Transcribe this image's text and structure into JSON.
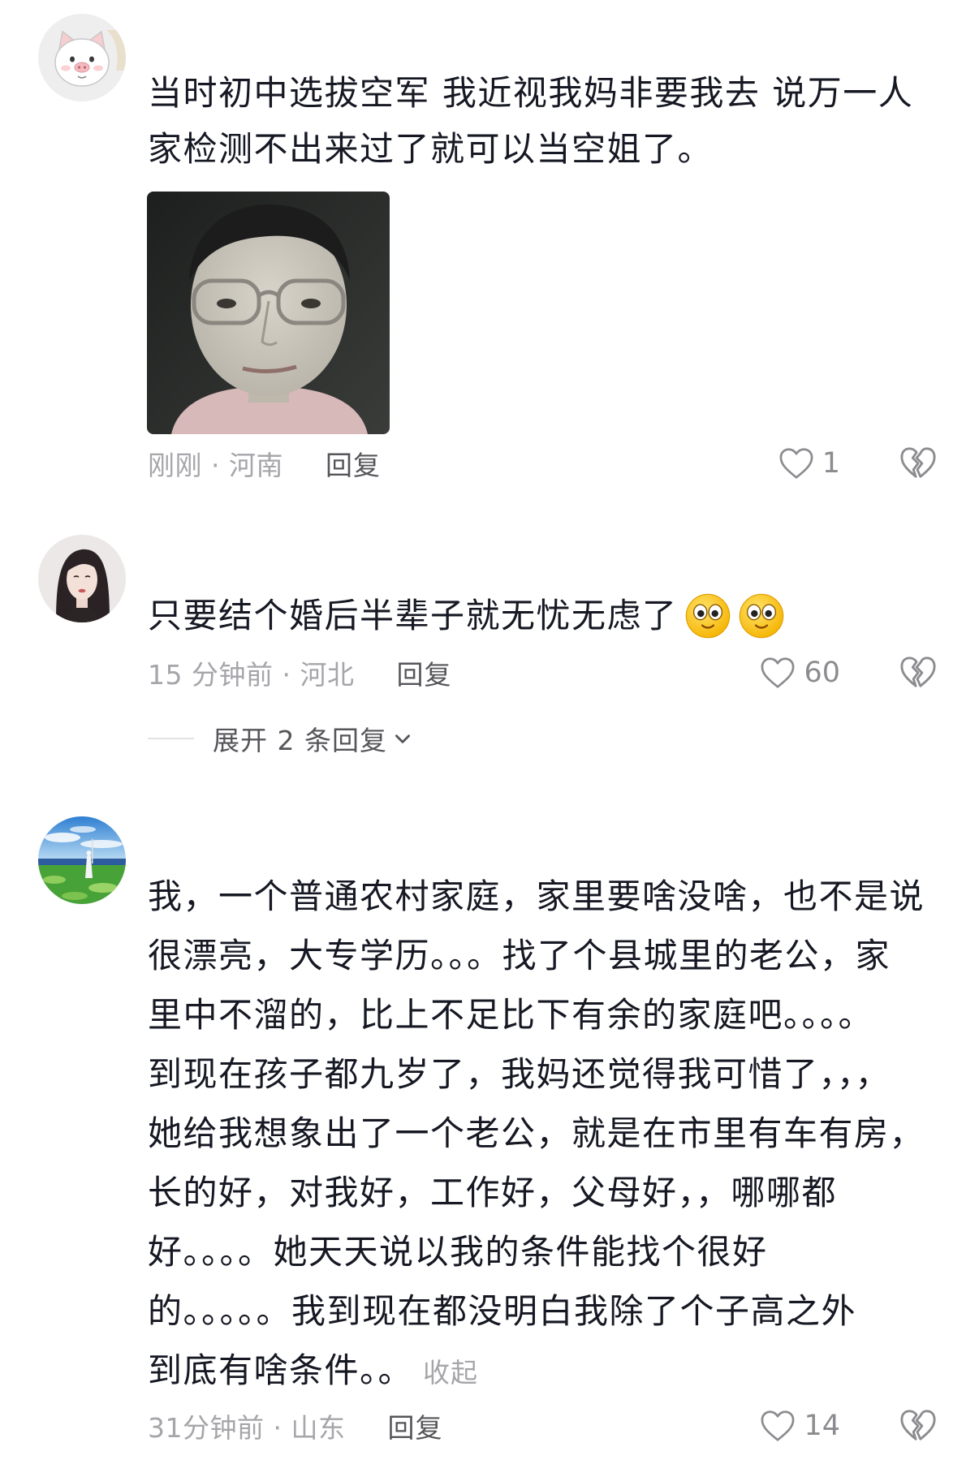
{
  "colors": {
    "background": "#ffffff",
    "text": "#161823",
    "meta": "#a5a5aa",
    "action": "#55555a",
    "icon": "#8c8c90",
    "divider": "#e2e2e5"
  },
  "icons": {
    "like": "heart-outline-icon",
    "dislike": "broken-heart-icon",
    "expand": "chevron-down-icon",
    "emoji": "smiley-emoji-icon"
  },
  "comments": [
    {
      "avatar": "pig-cartoon-avatar",
      "text_lines": [
        "当时初中选拔空军 我近视我妈非要我去 说万一人",
        "家检测不出来过了就可以当空姐了。"
      ],
      "image": "face-with-glasses-photo",
      "meta": "刚刚 · 河南",
      "reply_label": "回复",
      "like_count": "1"
    },
    {
      "avatar": "girl-photo-avatar",
      "text_lines": [
        "只要结个婚后半辈子就无忧无虑了"
      ],
      "emojis": [
        "smiley-emoji-icon",
        "smiley-emoji-icon"
      ],
      "meta": "15 分钟前 · 河北",
      "reply_label": "回复",
      "like_count": "60",
      "expand_label": "展开 2 条回复"
    },
    {
      "avatar": "landscape-photo-avatar",
      "text_lines": [
        "我，一个普通农村家庭，家里要啥没啥，也不是说",
        "很漂亮，大专学历。。。找了个县城里的老公，家",
        "里中不溜的，比上不足比下有余的家庭吧。。。。",
        "到现在孩子都九岁了，我妈还觉得我可惜了，，，",
        "她给我想象出了一个老公，就是在市里有车有房，",
        "长的好，对我好，工作好，父母好，，哪哪都",
        "好。。。。她天天说以我的条件能找个很好",
        "的。。。。。我到现在都没明白我除了个子高之外",
        "到底有啥条件。。"
      ],
      "collapse_label": "收起",
      "meta": "31分钟前 · 山东",
      "reply_label": "回复",
      "like_count": "14"
    }
  ]
}
